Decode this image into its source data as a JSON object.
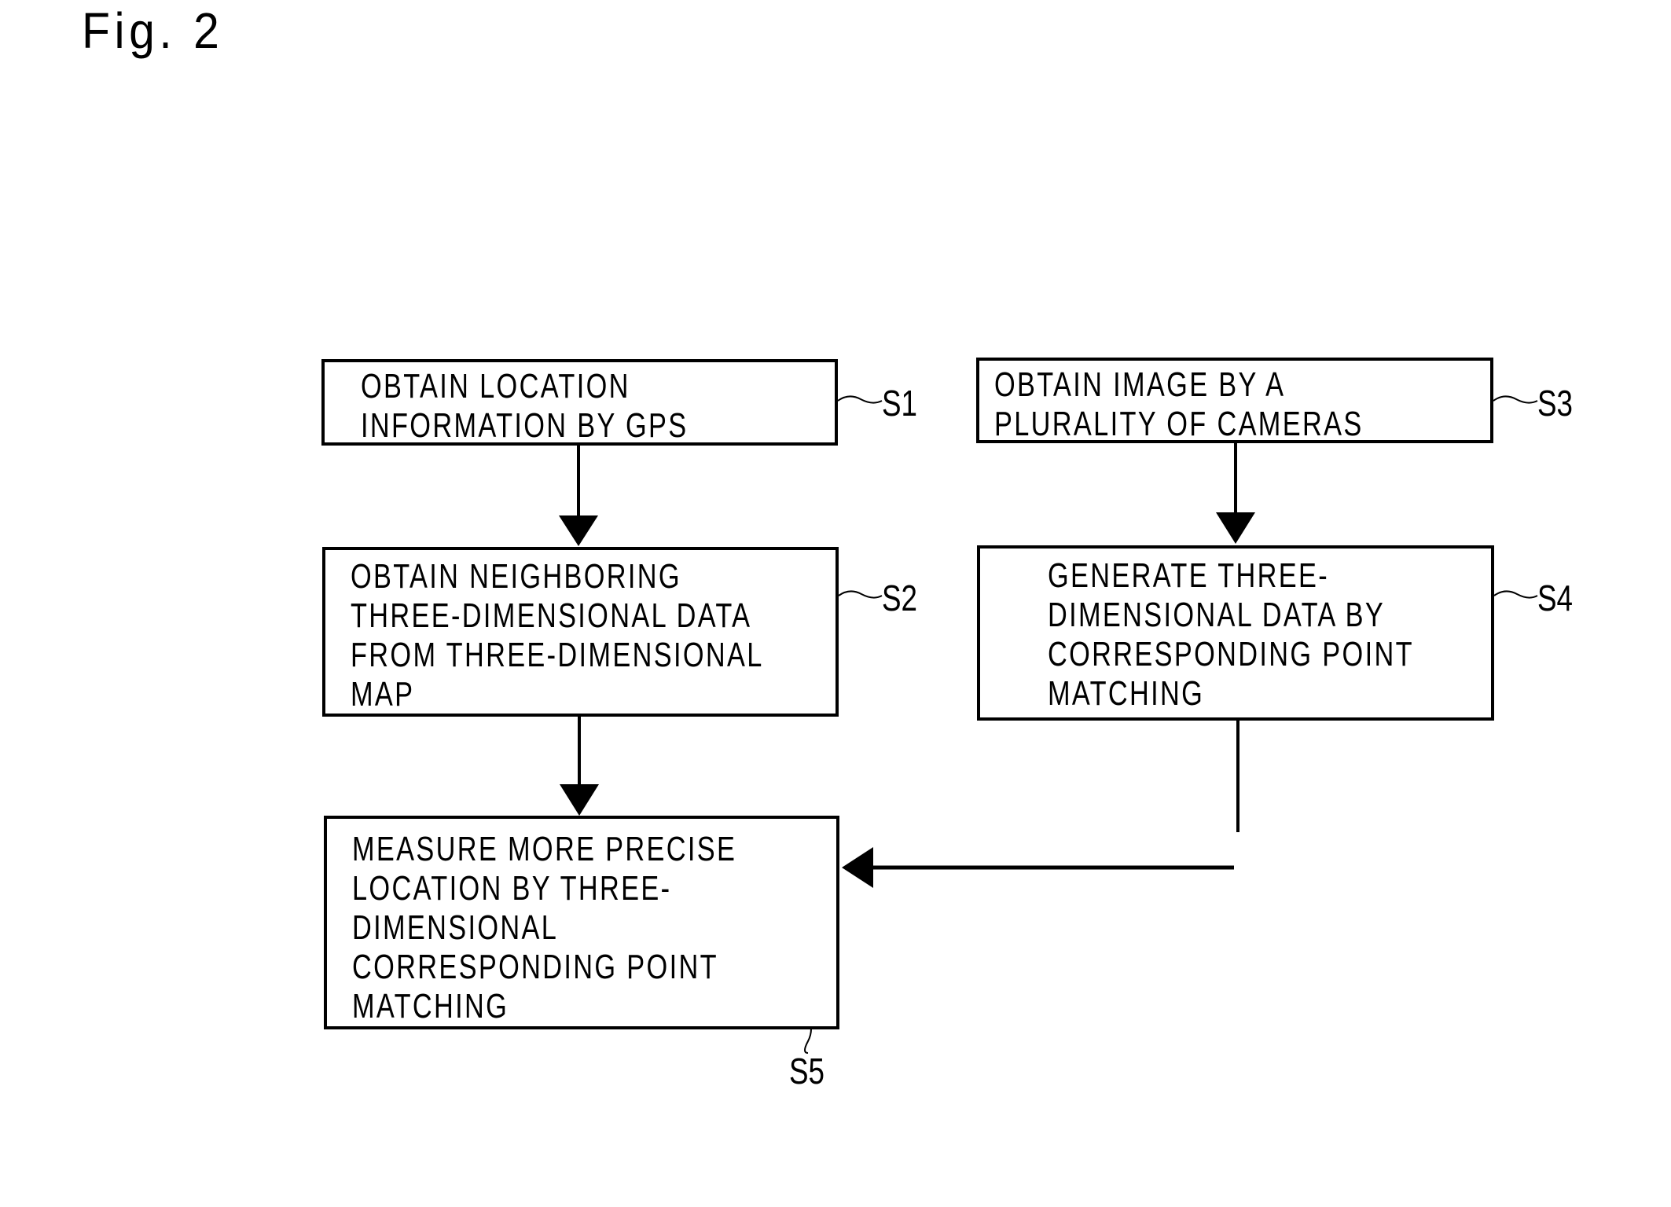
{
  "figure": {
    "title": "Fig. 2"
  },
  "steps": [
    {
      "id": "S1",
      "label": "S1",
      "lines": [
        "OBTAIN LOCATION",
        "INFORMATION BY GPS"
      ]
    },
    {
      "id": "S2",
      "label": "S2",
      "lines": [
        "OBTAIN NEIGHBORING",
        "THREE-DIMENSIONAL DATA",
        "FROM THREE-DIMENSIONAL",
        "MAP"
      ]
    },
    {
      "id": "S3",
      "label": "S3",
      "lines": [
        "OBTAIN IMAGE BY A",
        "PLURALITY OF CAMERAS"
      ]
    },
    {
      "id": "S4",
      "label": "S4",
      "lines": [
        "GENERATE THREE-",
        "DIMENSIONAL DATA BY",
        "CORRESPONDING POINT",
        "MATCHING"
      ]
    },
    {
      "id": "S5",
      "label": "S5",
      "lines": [
        "MEASURE MORE PRECISE",
        "LOCATION BY THREE-",
        "DIMENSIONAL",
        "CORRESPONDING POINT",
        "MATCHING"
      ]
    }
  ],
  "connections": [
    {
      "from": "S1",
      "to": "S2"
    },
    {
      "from": "S3",
      "to": "S4"
    },
    {
      "from": "S2",
      "to": "S5"
    },
    {
      "from": "S4",
      "to": "S5"
    }
  ]
}
